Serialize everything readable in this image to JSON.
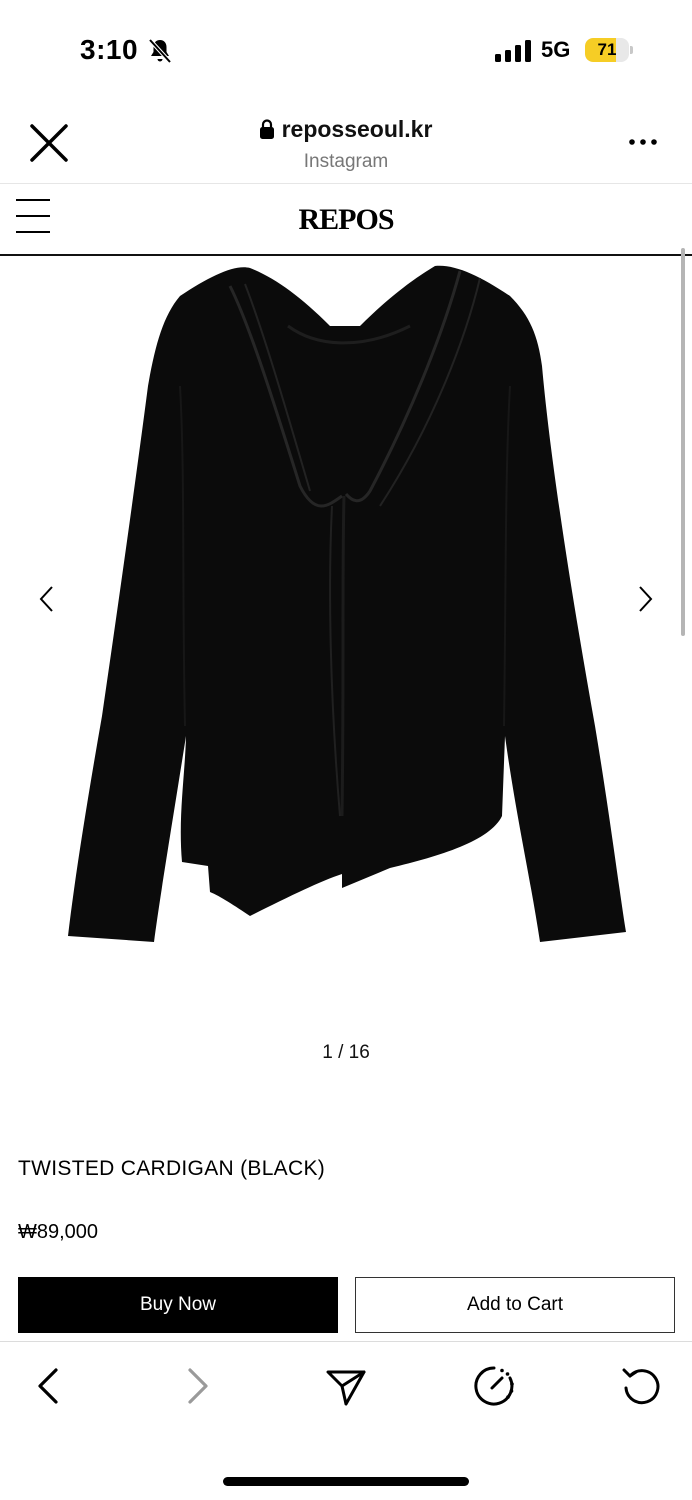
{
  "status_bar": {
    "time": "3:10",
    "network": "5G",
    "battery_level": 71,
    "battery_color": "#f6cd25",
    "icons": [
      "bell-slash-icon",
      "signal-icon",
      "battery-icon"
    ]
  },
  "browser": {
    "url": "reposseoul.kr",
    "source": "Instagram",
    "icons": [
      "close-icon",
      "lock-icon",
      "more-icon"
    ]
  },
  "site": {
    "logo": "REPOS",
    "menu_icon": "hamburger-menu-icon"
  },
  "product": {
    "image_counter": "1 / 16",
    "name": "TWISTED CARDIGAN (BLACK)",
    "price": "₩89,000",
    "buy_now_label": "Buy Now",
    "add_to_cart_label": "Add to Cart",
    "gallery_icons": [
      "chevron-left-icon",
      "chevron-right-icon"
    ]
  },
  "bottom_bar": {
    "icons": [
      "back-icon",
      "forward-icon",
      "share-icon",
      "performance-icon",
      "reload-icon"
    ]
  },
  "colors": {
    "primary": "#000000",
    "background": "#ffffff",
    "muted_text": "#777777"
  }
}
